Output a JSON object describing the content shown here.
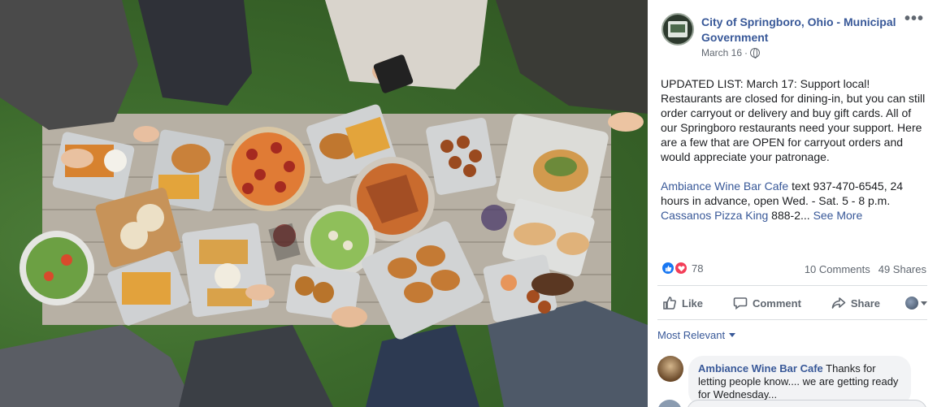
{
  "photo": {
    "alt_colors": {
      "table": "#b9b2a6",
      "grass": "#3c6a2c"
    }
  },
  "post": {
    "page_name": "City of Springboro, Ohio - Municipal Government",
    "date": "March 16",
    "separator": "·",
    "privacy_icon": "globe-icon",
    "more_icon": "more-options-icon",
    "body_paragraph_1": "UPDATED LIST: March 17: Support local! Restaurants are closed for dining-in, but you can still order carryout or delivery and buy gift cards. All of our Springboro restaurants need your support. Here are a few that are OPEN for carryout orders and would appreciate your patronage.",
    "body_link_1": "Ambiance Wine Bar Cafe",
    "body_text_after_link_1": " text 937-470-6545, 24 hours in advance, open Wed. - Sat. 5 - 8 p.m.",
    "body_link_2": "Cassanos Pizza King",
    "body_text_after_link_2": " 888-2...",
    "see_more": "See More"
  },
  "stats": {
    "reaction_count": "78",
    "comments": "10 Comments",
    "shares": "49 Shares"
  },
  "actions": {
    "like": "Like",
    "comment": "Comment",
    "share": "Share"
  },
  "comments_section": {
    "sort_label": "Most Relevant",
    "first_comment": {
      "author": "Ambiance Wine Bar Cafe",
      "text": " Thanks for letting people know.... we are getting ready for Wednesday..."
    }
  },
  "colors": {
    "link": "#385898",
    "like": "#1877f2",
    "love": "#f33e58",
    "secondary_text": "#606770"
  }
}
